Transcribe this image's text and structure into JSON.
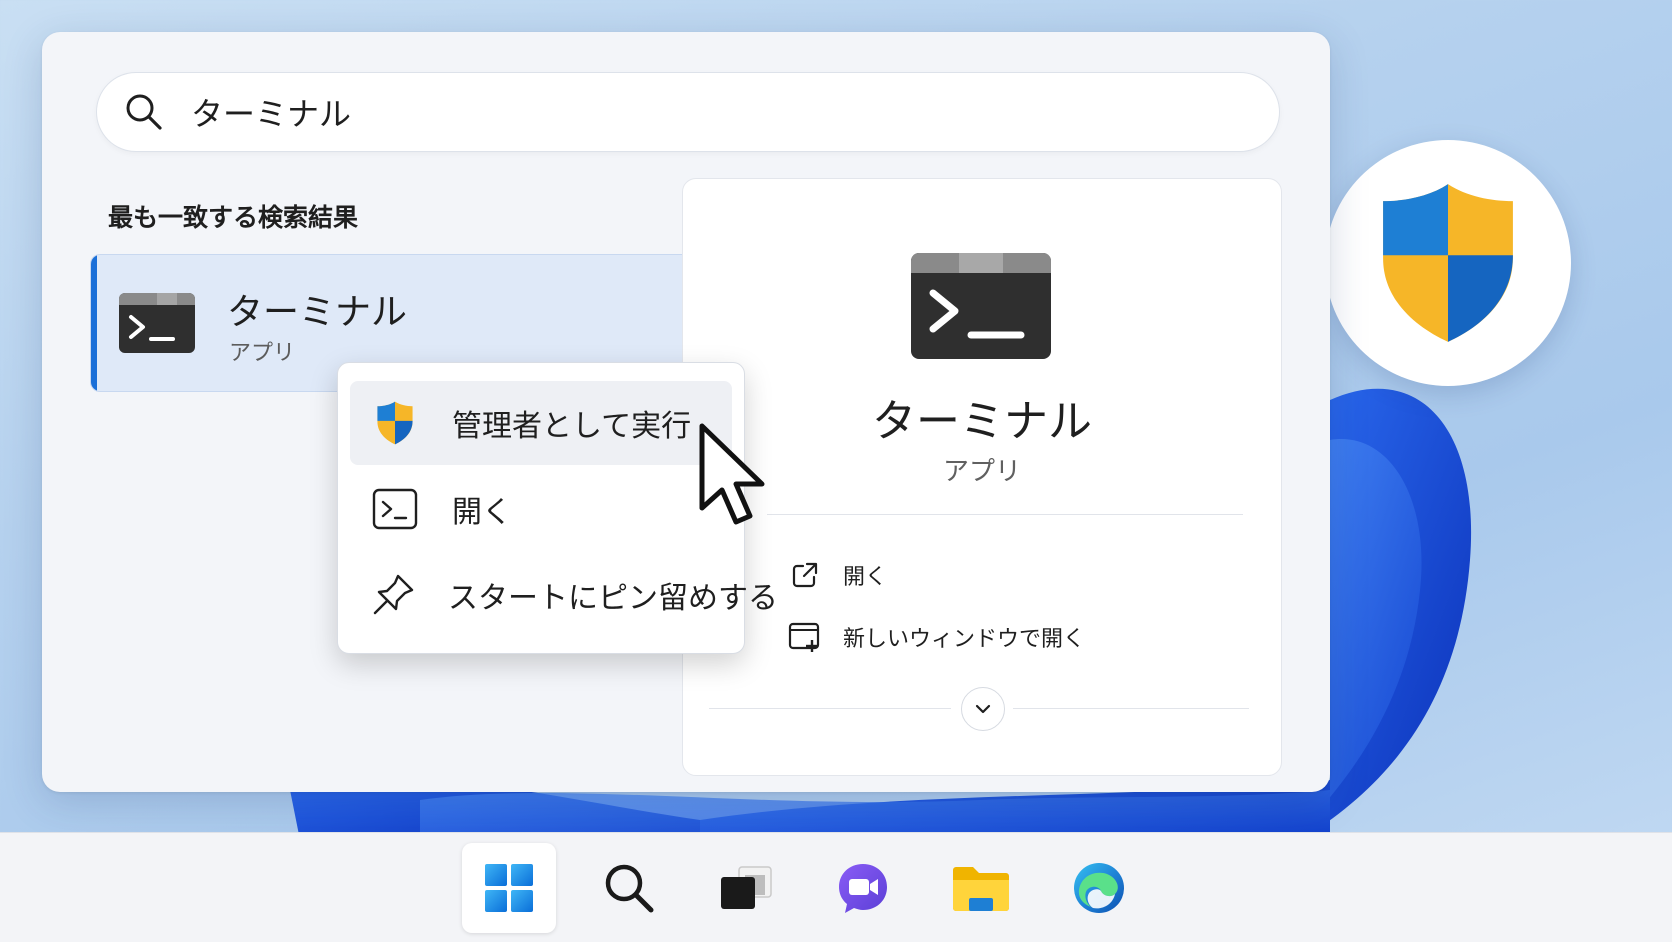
{
  "search": {
    "query": "ターミナル"
  },
  "results": {
    "section_heading": "最も一致する検索結果",
    "best_match": {
      "name": "ターミナル",
      "type": "アプリ",
      "icon": "terminal-icon"
    }
  },
  "context_menu": {
    "items": [
      {
        "label": "管理者として実行",
        "icon": "uac-shield-icon"
      },
      {
        "label": "開く",
        "icon": "terminal-icon"
      },
      {
        "label": "スタートにピン留めする",
        "icon": "pin-icon"
      }
    ]
  },
  "details": {
    "app_name": "ターミナル",
    "app_type": "アプリ",
    "actions": [
      {
        "label": "開く",
        "icon": "open-external-icon"
      },
      {
        "label": "新しいウィンドウで開く",
        "icon": "new-window-icon"
      }
    ]
  },
  "taskbar": {
    "items": [
      {
        "icon": "windows-start-icon"
      },
      {
        "icon": "search-icon"
      },
      {
        "icon": "task-view-icon"
      },
      {
        "icon": "teams-icon"
      },
      {
        "icon": "file-explorer-icon"
      },
      {
        "icon": "edge-icon"
      }
    ]
  },
  "colors": {
    "accent": "#1a6fd8",
    "shield_blue": "#1e7fd4",
    "shield_yellow": "#f6b628"
  }
}
